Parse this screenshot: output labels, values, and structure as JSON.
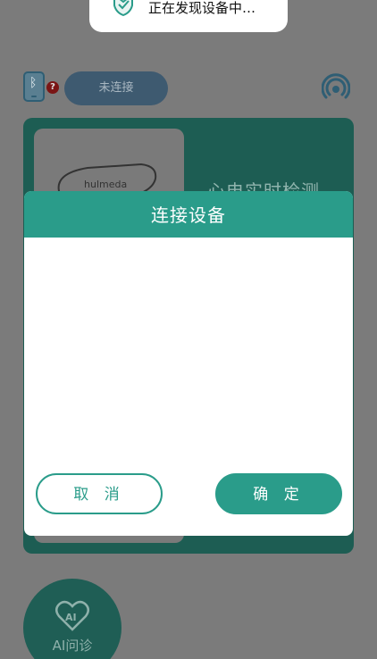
{
  "toast": {
    "text": "正在发现设备中…",
    "icon": "shield-check-icon"
  },
  "topbar": {
    "status_label": "未连接",
    "phone_icon": "bluetooth-phone-icon",
    "help_icon": "question-badge-icon",
    "signal_icon": "signal-broadcast-icon"
  },
  "card": {
    "title": "心电实时检测",
    "device_label": "hulmeda"
  },
  "ai": {
    "label": "AI问诊",
    "icon_text": "AI"
  },
  "dialog": {
    "title": "连接设备",
    "cancel_label": "取 消",
    "confirm_label": "确 定"
  },
  "colors": {
    "accent": "#2a9c8a",
    "overlay": "#7b7b7b"
  }
}
